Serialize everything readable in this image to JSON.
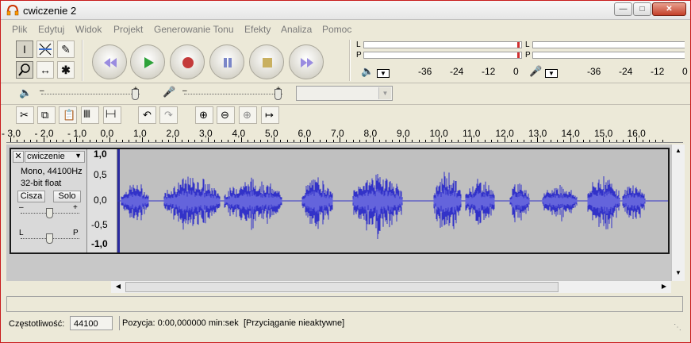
{
  "window": {
    "title": "cwiczenie 2"
  },
  "menu": [
    "Plik",
    "Edytuj",
    "Widok",
    "Projekt",
    "Generowanie Tonu",
    "Efekty",
    "Analiza",
    "Pomoc"
  ],
  "meters": {
    "left_label": "L",
    "right_label": "P",
    "play_scale": [
      "-36",
      "-24",
      "-12",
      "0"
    ],
    "rec_scale": [
      "-36",
      "-24",
      "-12",
      "0"
    ]
  },
  "ruler": {
    "labels": [
      "- 3,0",
      "- 2,0",
      "- 1,0",
      "0,0",
      "1,0",
      "2,0",
      "3,0",
      "4,0",
      "5,0",
      "6,0",
      "7,0",
      "8,0",
      "9,0",
      "10,0",
      "11,0",
      "12,0",
      "13,0",
      "14,0",
      "15,0",
      "16,0"
    ]
  },
  "track": {
    "name": "cwiczenie",
    "format": "Mono, 44100Hz",
    "bit_depth": "32-bit float",
    "mute_label": "Cisza",
    "solo_label": "Solo",
    "gain_minus": "–",
    "gain_plus": "+",
    "pan_left": "L",
    "pan_right": "P",
    "vruler": [
      "1,0",
      "0,5",
      "0,0",
      "-0,5",
      "-1,0"
    ]
  },
  "status": {
    "rate_label": "Częstotliwość:",
    "rate_value": "44100",
    "position_text": "Pozycja: 0:00,000000 min:sek",
    "snap_text": "[Przyciąganie nieaktywne]"
  },
  "colors": {
    "waveform": "#3232c8",
    "waveform_rms": "#6464dc",
    "track_bg": "#c0c0c0",
    "window_border": "#c81a1a"
  },
  "icons": {
    "app": "audacity-headphones-icon",
    "minimize": "minimize-icon",
    "maximize": "maximize-icon",
    "close": "close-icon"
  }
}
